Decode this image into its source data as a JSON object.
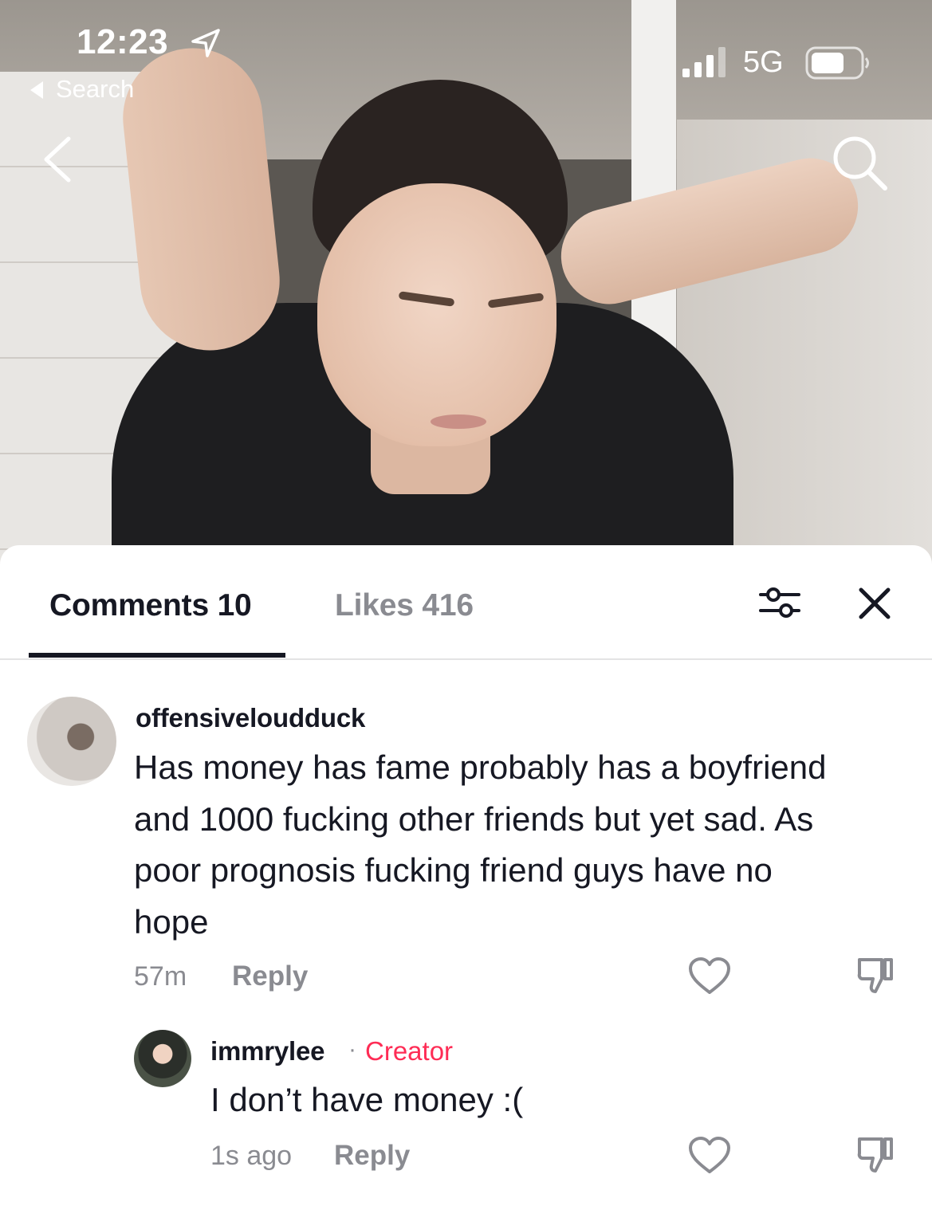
{
  "status_bar": {
    "time": "12:23",
    "back_app_label": "Search",
    "network": "5G",
    "icons": [
      "location-arrow-icon",
      "signal-icon",
      "battery-icon"
    ]
  },
  "video_nav": {
    "back_icon": "chevron-left-icon",
    "search_icon": "search-icon"
  },
  "tabs": {
    "comments_label": "Comments 10",
    "likes_label": "Likes 416",
    "active": "comments",
    "filter_icon": "sliders-icon",
    "close_icon": "close-icon"
  },
  "comments": [
    {
      "username": "offensiveloudduck",
      "text": "Has money has fame probably has a boyfriend and 1000 fucking other friends but yet sad. As poor prognosis fucking friend guys have no hope",
      "time": "57m",
      "reply_label": "Reply"
    },
    {
      "username": "immrylee",
      "separator": "·",
      "badge": "Creator",
      "text": "I don’t have money :(",
      "time": "1s ago",
      "reply_label": "Reply"
    }
  ],
  "colors": {
    "text_primary": "#161823",
    "text_secondary": "#8a8b91",
    "creator_accent": "#fe2c55",
    "divider": "#e3e3e4"
  }
}
